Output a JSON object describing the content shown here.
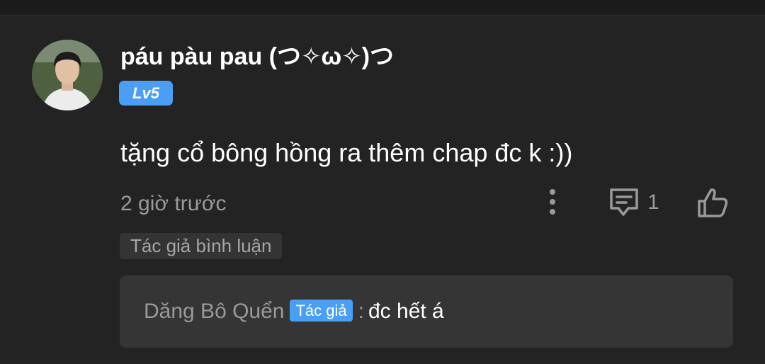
{
  "comment": {
    "username": "páu pàu pau (つ✧ω✧)つ",
    "level": "Lv5",
    "text": "tặng cổ bông hồng ra thêm chap đc k :))",
    "time": "2 giờ trước",
    "reply_count": "1",
    "icons": {
      "avatar": "user-avatar",
      "more": "more-vertical-icon",
      "reply": "comment-icon",
      "like": "thumbs-up-icon"
    }
  },
  "author_tag": "Tác giả bình luận",
  "reply": {
    "author": "Dăng Bô Quển",
    "badge": "Tác giả",
    "separator": ":",
    "text": "đc hết á"
  },
  "colors": {
    "background": "#232323",
    "accent": "#4a9ff5",
    "muted_text": "#9a9a9a",
    "reply_box": "#353535"
  }
}
